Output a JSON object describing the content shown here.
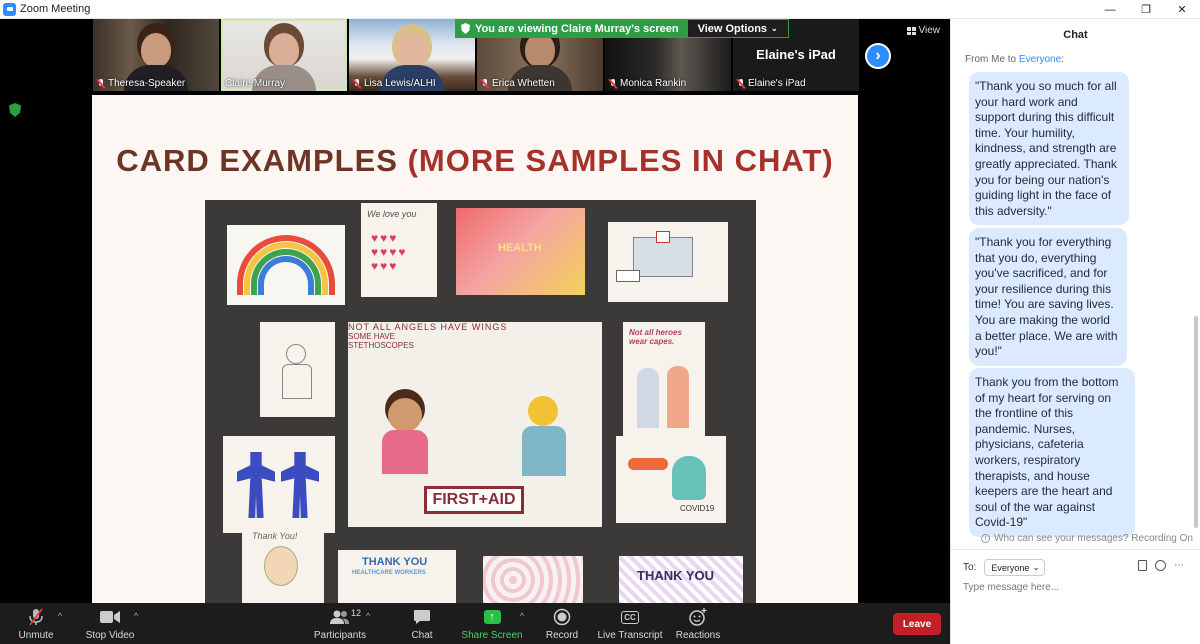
{
  "window": {
    "title": "Zoom Meeting",
    "controls": [
      "—",
      "❐",
      "✕"
    ]
  },
  "share_banner": {
    "text": "You are viewing Claire Murray's screen",
    "view_options": "View Options"
  },
  "view_button": "View",
  "participants_strip": [
    {
      "name": "Theresa-Speaker",
      "muted": true
    },
    {
      "name": "Claire Murray",
      "muted": false,
      "selected": true
    },
    {
      "name": "Lisa Lewis/ALHI",
      "muted": true
    },
    {
      "name": "Erica Whetten",
      "muted": true
    },
    {
      "name": "Monica Rankin",
      "muted": true
    },
    {
      "name": "Elaine's iPad",
      "muted": true,
      "video_off_label": "Elaine's iPad"
    }
  ],
  "slide": {
    "title_main": "CARD EXAMPLES ",
    "title_accent": "(MORE SAMPLES IN CHAT)",
    "card_texts": {
      "health": "HEALTH",
      "angels": "NOT ALL ANGELS HAVE WINGS",
      "some_have": "SOME HAVE",
      "stethoscopes": "STETHOSCOPES",
      "first_aid": "FIRST+AID",
      "heroes": "Not all heroes wear capes.",
      "we_love_you": "We love you",
      "covid": "COVID19",
      "thank_you": "THANK YOU",
      "healthcare_workers": "HEALTHCARE WORKERS",
      "thank_you_script": "Thank You!"
    }
  },
  "toolbar": {
    "unmute": "Unmute",
    "stop_video": "Stop Video",
    "participants": "Participants",
    "participants_count": "12",
    "chat": "Chat",
    "share_screen": "Share Screen",
    "record": "Record",
    "live_transcript": "Live Transcript",
    "reactions": "Reactions",
    "leave": "Leave",
    "cc_icon_text": "CC"
  },
  "chat": {
    "header": "Chat",
    "from_prefix": "From Me to ",
    "from_to": "Everyone",
    "from_suffix": ":",
    "messages": [
      "\"Thank you so much for all your hard work and support during this difficult time. Your humility, kindness, and strength are greatly appreciated.  Thank you for being our nation's guiding light in the face of this adversity.\"",
      "\"Thank you for everything that you do, everything you've sacrificed, and for your resilience during this time! You are saving lives. You are making the world a better place. We are with you!\"",
      "Thank you from the bottom of my heart for serving on the frontline of this pandemic.  Nurses, physicians, cafeteria workers, respiratory therapists, and house keepers are the heart and soul of the war against Covid-19\""
    ],
    "privacy_text": "Who can see your messages? Recording On",
    "to_label": "To:",
    "to_value": "Everyone",
    "input_placeholder": "Type message here..."
  },
  "colors": {
    "zoom_blue": "#2d8cff",
    "share_green": "#2e9e46",
    "leave_red": "#c41f26",
    "bubble": "#dbeafe",
    "slide_title": "#6e3527",
    "slide_title_accent": "#a4322b"
  }
}
